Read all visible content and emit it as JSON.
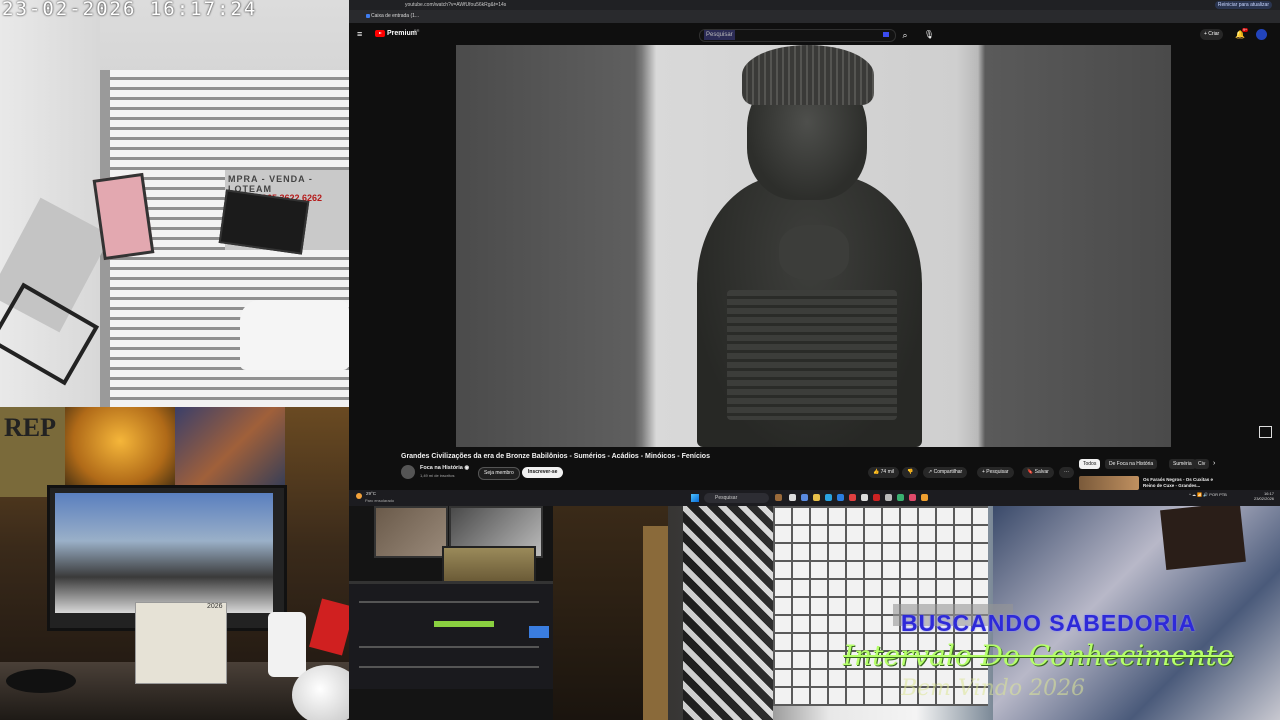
{
  "camera_street": {
    "timestamp": "23-02-2026  16:17:24",
    "sign_text": "MPRA - VENDA - LOTEAM",
    "sign_phone": "965 3622 6262"
  },
  "browser": {
    "url": "youtube.com/watch?v=AWfUfou56kRg&t=14s",
    "bookmark": "Caixa de entrada (1...",
    "reload_label": "Reiniciar para atualizar"
  },
  "youtube": {
    "logo_text": "Premium",
    "logo_sup": "BR",
    "search_placeholder": "Pesquisar",
    "create_label": "+ Criar",
    "bell_badge": "9+",
    "video_title": "Grandes Civilizações da era de Bronze Babilônios - Sumérios - Acádios - Minóicos - Fenícios",
    "channel_name": "Foca na História ◉",
    "channel_subs": "1,49 mi de inscritos",
    "member_label": "Seja membro",
    "subscribe_label": "Inscrever-se",
    "like_label": "👍 74 mil",
    "dislike_label": "👎",
    "share_label": "↗ Compartilhar",
    "download_label": "+ Pesquisar",
    "save_label": "🔖 Salvar",
    "more_label": "···",
    "chips": [
      "Todos",
      "De Foca na História",
      "Suméria",
      "Civ"
    ],
    "related_title": "Os Faraós Negros - Os Cuxitas e Reino de Cuxe - Grandes..."
  },
  "taskbar": {
    "weather_temp": "29°C",
    "weather_desc": "Parc ensolarado",
    "search_placeholder": "Pesquisar",
    "tray_text": "^ ☁ 📶 🔊 POR PTB",
    "time": "16:17",
    "date": "23/02/2026"
  },
  "cam_desk": {
    "poster_text": "REP",
    "calendar_year": "2026"
  },
  "overlay": {
    "line1": "BUSCANDO SABEDORIA",
    "line2": "Intervalo Do Conhecimento",
    "line3": "Bem Vindo 2026"
  },
  "colors": {
    "youtube_red": "#ff0000",
    "overlay_blue": "#2e2ad8",
    "overlay_green": "#b6ff6a"
  }
}
